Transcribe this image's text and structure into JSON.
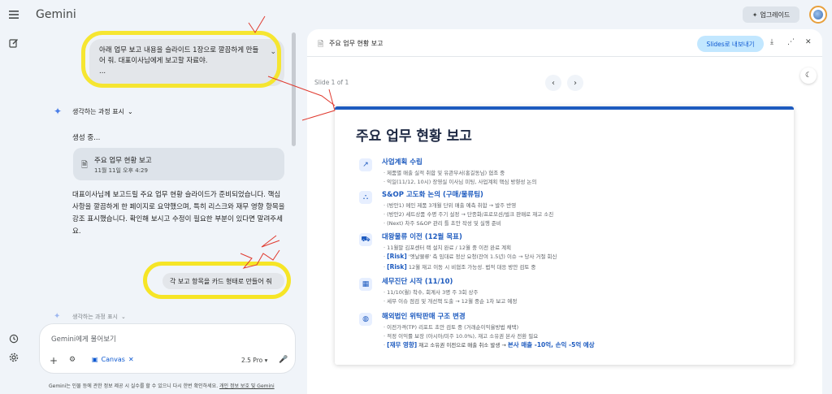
{
  "app": {
    "title": "Gemini"
  },
  "header": {
    "upgrade_label": "업그레이드"
  },
  "chat": {
    "user_message_1": "아래 업무 보고 내용을 슬라이드 1장으로 깔끔하게 만들어 줘. 대표이사님에게 보고할 자료야.",
    "user_message_1_more": "...",
    "thinking_label": "생각하는 과정 표시",
    "generating_text": "생성 중...",
    "doc_card": {
      "title": "주요 업무 현황 보고",
      "date": "11월 11일 오후 4:29"
    },
    "answer_text": "대표이사님께 보고드릴 주요 업무 현황 슬라이드가 준비되었습니다. 핵심 사항을 깔끔하게 한 페이지로 요약했으며, 특히 리스크와 재무 영향 항목을 강조 표시했습니다. 확인해 보시고 수정이 필요한 부분이 있다면 말려주세요.",
    "user_message_2": "각 보고 항목을 카드 형태로 만들어 줘",
    "thinking_label_2": "생각하는 과정 표시"
  },
  "input": {
    "placeholder": "Gemini에게 물어보기",
    "canvas_chip": "Canvas",
    "model": "2.5 Pro"
  },
  "disclaimer": {
    "text": "Gemini는 인물 등에 관한 정보 제공 시 실수를 할 수 있으니 다시 한번 확인하세요.",
    "link": "개인 정보 보호 및 Gemini"
  },
  "panel": {
    "title": "주요 업무 현황 보고",
    "export_label": "Slides로 내보내기",
    "slide_count": "Slide 1 of 1"
  },
  "slide": {
    "title": "주요 업무 현황 보고",
    "sections": [
      {
        "icon": "trend-chart-icon",
        "title": "사업계획 수립",
        "lines": [
          "· 제품별 매출 실적 취합 및 유관부서(홍길동님) 협조 중",
          "· 익일(11/12, 10시) 장영실 이사님 미팅, 사업계획 핵심 방향성 논의"
        ]
      },
      {
        "icon": "network-icon",
        "title": "S&OP 고도화 논의 (구매/물류팀)",
        "lines": [
          "· (방안1) 메인 제품 3개월 단위 매출 예측 취합 → 발주 반영",
          "· (방안2) 세트상품 수명 주기 설정 → 단종화/프로모션/벌크 판매로 재고 소진",
          "· (Next) 차주 S&OP 관리 틀 초안 작성 및 실행 준비"
        ]
      },
      {
        "icon": "truck-icon",
        "title": "대왕물류 이전 (12월 목표)",
        "line1": "· 11월말 김포센터 랙 설치 완료 / 12월 중 이전 완료 계획",
        "risk_label": "[Risk]",
        "risk1": " '엣날물류' 측 임대료 정산 요청(잔여 1.5년) 이슈 → 당사 거절 회신",
        "risk2": " 12월 재고 이동 시 비협조 가능성. 법적 대응 방안 검토 중"
      },
      {
        "icon": "calculator-icon",
        "title": "세무진단 시작 (11/10)",
        "lines": [
          "· 11/10(월) 착수, 회계사 3명 주 3회 상주",
          "· 세무 이슈 점검 및 개선책 도출 → 12월 중순 1차 보고 예정"
        ]
      },
      {
        "icon": "globe-icon",
        "title": "해외법인 위탁판매 구조 변경",
        "line1": "· 이전가격(TP) 리포트 초안 검토 중 (거래순이익율방법 채택)",
        "line2": "· 적정 이익률 보장 (아시아/미주 10.0%), 재고 소유권 본사 전환 필요",
        "finance_label": "[재무 영향]",
        "finance_text": " 재고 소유권 이전으로 매출 취소 발생 → ",
        "finance_emph": "본사 매출 -10억, 손익 -5억 예상"
      }
    ]
  },
  "colors": {
    "accent": "#1e5bbf",
    "highlight": "#f6e526",
    "annotation": "#e03a2f",
    "export_button": "#c2e7ff"
  }
}
